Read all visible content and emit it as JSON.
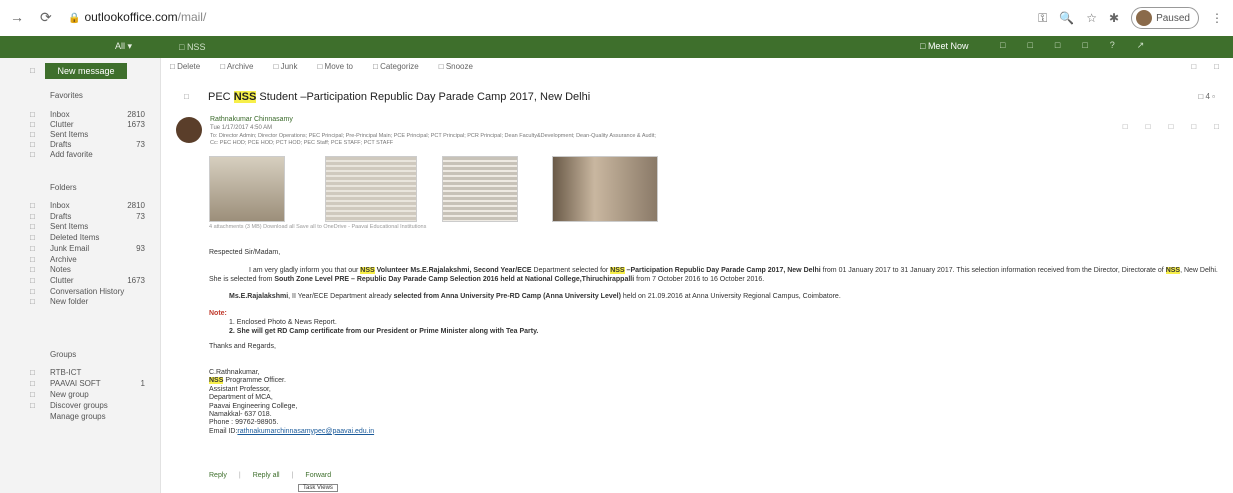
{
  "browser": {
    "url_host": "outlookoffice.com",
    "url_path": "/mail/",
    "paused_label": "Paused"
  },
  "topbar": {
    "search_scope": "All",
    "search_text": "NSS",
    "meet_now": "Meet Now"
  },
  "sidebar": {
    "new_message": "New message",
    "favorites_header": "Favorites",
    "favorites": [
      {
        "label": "Inbox",
        "count": "2810"
      },
      {
        "label": "Clutter",
        "count": "1673"
      },
      {
        "label": "Sent Items",
        "count": ""
      },
      {
        "label": "Drafts",
        "count": "73"
      },
      {
        "label": "Add favorite",
        "count": ""
      }
    ],
    "folders_header": "Folders",
    "folders": [
      {
        "label": "Inbox",
        "count": "2810"
      },
      {
        "label": "Drafts",
        "count": "73"
      },
      {
        "label": "Sent Items",
        "count": ""
      },
      {
        "label": "Deleted Items",
        "count": ""
      },
      {
        "label": "Junk Email",
        "count": "93"
      },
      {
        "label": "Archive",
        "count": ""
      },
      {
        "label": "Notes",
        "count": ""
      },
      {
        "label": "Clutter",
        "count": "1673"
      },
      {
        "label": "Conversation History",
        "count": ""
      },
      {
        "label": "New folder",
        "count": ""
      }
    ],
    "groups_header": "Groups",
    "groups": [
      {
        "label": "RTB-ICT",
        "count": ""
      },
      {
        "label": "PAAVAI SOFT",
        "count": "1"
      },
      {
        "label": "New group",
        "count": ""
      },
      {
        "label": "Discover groups",
        "count": ""
      },
      {
        "label": "Manage groups",
        "count": ""
      }
    ]
  },
  "commands": [
    "Delete",
    "Archive",
    "Junk",
    "Move to",
    "Categorize",
    "Snooze"
  ],
  "email": {
    "subject_pre": "PEC ",
    "subject_hl": "NSS",
    "subject_post": " Student –Participation Republic Day Parade Camp 2017, New Delhi",
    "thread_count": "4",
    "sender": "Rathnakumar Chinnasamy",
    "date": "Tue 1/17/2017 4:50 AM",
    "to_line": "To: Director Admin; Director Operations; PEC Principal; Pre-Principal Main; PCE Principal; PCT Principal; PCR Principal; Dean Faculty&Development; Dean-Quality Assurance & Audit;",
    "cc_line": "Cc: PEC HOD; PCE HOD; PCT HOD; PEC Staff; PCE STAFF; PCT STAFF",
    "attachments": "4 attachments (3 MB)    Download all    Save all to OneDrive - Paavai Educational Institutions",
    "greeting": "Respected Sir/Madam,",
    "para1_a": "I am very gladly inform you that our ",
    "para1_hl1": "NSS",
    "para1_b": " Volunteer Ms.E.Rajalakshmi, Second Year/ECE",
    "para1_c": " Department selected for ",
    "para1_hl2": "NSS",
    "para1_d": " –Participation Republic Day Parade Camp 2017, New Delhi",
    "para1_e": " from  01 January 2017 to 31 January 2017. This selection information received from the Director, Directorate of ",
    "para1_hl3": "NSS",
    "para1_f": ", New Delhi. She is selected from ",
    "para1_g": "South Zone Level PRE – Republic Day Parade Camp Selection 2016 held at National College,Thiruchirappalli",
    "para1_h": " from 7 October 2016 to 16 October 2016.",
    "para2_a": "Ms.E.Rajalakshmi",
    "para2_b": ", II Year/ECE Department already ",
    "para2_c": "selected from Anna University Pre-RD Camp (Anna University Level)",
    "para2_d": " held on 21.09.2016 at Anna University Regional Campus, Coimbatore.",
    "note_label": "Note:",
    "note1": "Enclosed Photo & News Report.",
    "note2": "She will get RD Camp certificate from our President or Prime Minister along with Tea Party.",
    "thanks": "Thanks and Regards,",
    "sig_name": "C.Rathnakumar,",
    "sig_hl": "NSS",
    "sig_role": " Programme Officer.",
    "sig_lines": [
      "Assistant Professor,",
      "Department of MCA,",
      "Paavai Engineering College,",
      "Namakkal- 637 018.",
      "Phone : 99762-98905."
    ],
    "sig_email_label": "Email ID:",
    "sig_email": "rathnakumarchinnasamypec@paavai.edu.in",
    "reply": "Reply",
    "reply_all": "Reply all",
    "forward": "Forward",
    "tooltip": "Task Views"
  }
}
